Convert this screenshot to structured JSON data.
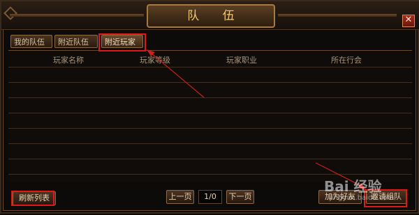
{
  "window": {
    "title": "队 伍",
    "close_glyph": "✕"
  },
  "tabs": [
    {
      "label": "我的队伍",
      "active": false
    },
    {
      "label": "附近队伍",
      "active": false
    },
    {
      "label": "附近玩家",
      "active": true
    }
  ],
  "table": {
    "columns": [
      "玩家名称",
      "玩家等级",
      "玩家职业",
      "所在行会"
    ],
    "rows": []
  },
  "footer": {
    "refresh_label": "刷新列表",
    "prev_label": "上一页",
    "page_indicator": "1/0",
    "next_label": "下一页",
    "left_action_label": "加为好友",
    "right_action_label": "邀请组队"
  },
  "watermark": {
    "logo": "Bai 经验",
    "site": "jingyan.baidu.com"
  },
  "colors": {
    "highlight": "#e01818",
    "title_text": "#f0c878",
    "panel_bg": "#0d0b0a"
  }
}
